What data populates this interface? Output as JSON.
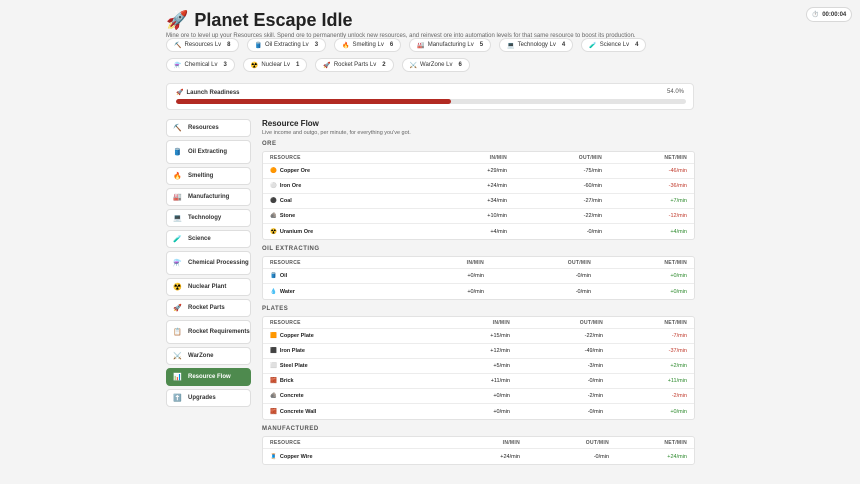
{
  "app": {
    "title": "Planet Escape Idle",
    "title_icon": "🚀",
    "subtitle": "Mine ore to level up your Resources skill. Spend ore to permanently unlock new resources, and reinvest ore into automation levels for that same resource to boost its production."
  },
  "timer": {
    "icon": "⏱️",
    "value": "00:00:04"
  },
  "skills": [
    {
      "icon": "⛏️",
      "label": "Resources Lv",
      "level": "8"
    },
    {
      "icon": "🛢️",
      "label": "Oil Extracting Lv",
      "level": "3"
    },
    {
      "icon": "🔥",
      "label": "Smelting Lv",
      "level": "6"
    },
    {
      "icon": "🏭",
      "label": "Manufacturing Lv",
      "level": "5"
    },
    {
      "icon": "💻",
      "label": "Technology Lv",
      "level": "4"
    },
    {
      "icon": "🧪",
      "label": "Science Lv",
      "level": "4"
    },
    {
      "icon": "⚗️",
      "label": "Chemical Lv",
      "level": "3"
    },
    {
      "icon": "☢️",
      "label": "Nuclear Lv",
      "level": "1"
    },
    {
      "icon": "🚀",
      "label": "Rocket Parts Lv",
      "level": "2"
    },
    {
      "icon": "⚔️",
      "label": "WarZone Lv",
      "level": "6"
    }
  ],
  "launch": {
    "icon": "🚀",
    "label": "Launch Readiness",
    "percent_text": "54.0%",
    "fraction": 0.54
  },
  "sidebar": [
    {
      "icon": "⛏️",
      "label": "Resources",
      "active": false
    },
    {
      "icon": "🛢️",
      "label": "Oil Extracting",
      "active": false
    },
    {
      "icon": "🔥",
      "label": "Smelting",
      "active": false
    },
    {
      "icon": "🏭",
      "label": "Manufacturing",
      "active": false
    },
    {
      "icon": "💻",
      "label": "Technology",
      "active": false
    },
    {
      "icon": "🧪",
      "label": "Science",
      "active": false
    },
    {
      "icon": "⚗️",
      "label": "Chemical Processing",
      "active": false
    },
    {
      "icon": "☢️",
      "label": "Nuclear Plant",
      "active": false
    },
    {
      "icon": "🚀",
      "label": "Rocket Parts",
      "active": false
    },
    {
      "icon": "📋",
      "label": "Rocket Requirements",
      "active": false
    },
    {
      "icon": "⚔️",
      "label": "WarZone",
      "active": false
    },
    {
      "icon": "📊",
      "label": "Resource Flow",
      "active": true
    },
    {
      "icon": "⬆️",
      "label": "Upgrades",
      "active": false
    }
  ],
  "panel": {
    "title": "Resource Flow",
    "subtitle": "Live income and outgo, per minute, for everything you've got."
  },
  "columns": {
    "resource": "RESOURCE",
    "in": "IN/MIN",
    "out": "OUT/MIN",
    "net": "NET/MIN"
  },
  "sections": [
    {
      "title": "ORE",
      "rows": [
        {
          "icon": "🟠",
          "name": "Copper Ore",
          "in": "+29/min",
          "out": "-75/min",
          "net": "-46/min",
          "sign": "neg"
        },
        {
          "icon": "⚪",
          "name": "Iron Ore",
          "in": "+24/min",
          "out": "-60/min",
          "net": "-36/min",
          "sign": "neg"
        },
        {
          "icon": "⚫",
          "name": "Coal",
          "in": "+34/min",
          "out": "-27/min",
          "net": "+7/min",
          "sign": "pos"
        },
        {
          "icon": "🪨",
          "name": "Stone",
          "in": "+10/min",
          "out": "-22/min",
          "net": "-12/min",
          "sign": "neg"
        },
        {
          "icon": "☢️",
          "name": "Uranium Ore",
          "in": "+4/min",
          "out": "-0/min",
          "net": "+4/min",
          "sign": "pos"
        }
      ]
    },
    {
      "title": "OIL EXTRACTING",
      "rows": [
        {
          "icon": "🛢️",
          "name": "Oil",
          "in": "+0/min",
          "out": "-0/min",
          "net": "+0/min",
          "sign": "zero"
        },
        {
          "icon": "💧",
          "name": "Water",
          "in": "+0/min",
          "out": "-0/min",
          "net": "+0/min",
          "sign": "zero"
        }
      ]
    },
    {
      "title": "PLATES",
      "rows": [
        {
          "icon": "🟧",
          "name": "Copper Plate",
          "in": "+15/min",
          "out": "-22/min",
          "net": "-7/min",
          "sign": "neg"
        },
        {
          "icon": "⬛",
          "name": "Iron Plate",
          "in": "+12/min",
          "out": "-49/min",
          "net": "-37/min",
          "sign": "neg"
        },
        {
          "icon": "⬜",
          "name": "Steel Plate",
          "in": "+5/min",
          "out": "-3/min",
          "net": "+2/min",
          "sign": "pos"
        },
        {
          "icon": "🧱",
          "name": "Brick",
          "in": "+11/min",
          "out": "-0/min",
          "net": "+11/min",
          "sign": "pos"
        },
        {
          "icon": "🪨",
          "name": "Concrete",
          "in": "+0/min",
          "out": "-2/min",
          "net": "-2/min",
          "sign": "neg"
        },
        {
          "icon": "🧱",
          "name": "Concrete Wall",
          "in": "+0/min",
          "out": "-0/min",
          "net": "+0/min",
          "sign": "zero"
        }
      ]
    },
    {
      "title": "MANUFACTURED",
      "rows": [
        {
          "icon": "🧵",
          "name": "Copper Wire",
          "in": "+24/min",
          "out": "-0/min",
          "net": "+24/min",
          "sign": "pos"
        }
      ]
    }
  ]
}
